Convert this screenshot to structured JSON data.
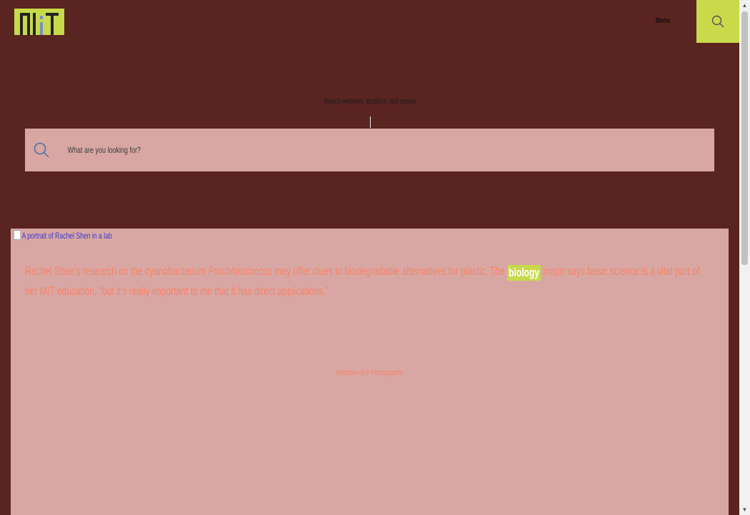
{
  "header": {
    "logo_alt": "MIT",
    "menu_label": "Menu",
    "menu_chevron": "⌄",
    "search_icon": "search-icon"
  },
  "search": {
    "heading": "Search websites, locations, and people",
    "placeholder": "What are you looking for?"
  },
  "feature": {
    "image_alt": "A portrait of Rachel Shen in a lab",
    "caption_part1": "Rachel Shen’s research on the cyanobacterium ",
    "caption_organism": "Prochlorococcus",
    "caption_part2": " may offer clues to biodegradable alternatives for plastic. The ",
    "caption_tag": "biology",
    "caption_part3": " major says basic science is a vital part of her MIT education, “but it’s really important to me that it has direct applications.”",
    "credit": "Gretchen Ertl Photography"
  },
  "colors": {
    "background": "#5a2421",
    "accent": "#c8d94a",
    "panel": "#d9a7a3",
    "caption": "#f5836a"
  }
}
